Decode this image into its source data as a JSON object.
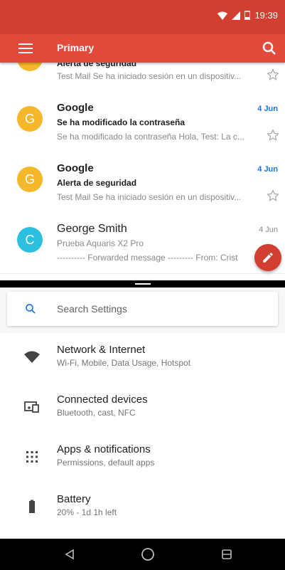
{
  "status_bar": {
    "time": "19:39"
  },
  "app_bar": {
    "title": "Primary"
  },
  "emails": [
    {
      "sender": "Alerta de seguridad",
      "subject": "",
      "snippet": "Test Mail Se ha iniciado sesión en un dispositiv...",
      "date": "",
      "avatar_letter": "G",
      "avatar_color": "#f6b82b",
      "unread": true
    },
    {
      "sender": "Google",
      "subject": "Se ha modificado la contraseña",
      "snippet": "Se ha modificado la contraseña Hola, Test: La c...",
      "date": "4 Jun",
      "avatar_letter": "G",
      "avatar_color": "#f6b82b",
      "unread": true
    },
    {
      "sender": "Google",
      "subject": "Alerta de seguridad",
      "snippet": "Test Mail Se ha iniciado sesión en un dispositiv...",
      "date": "4 Jun",
      "avatar_letter": "G",
      "avatar_color": "#f6b82b",
      "unread": true
    },
    {
      "sender": "George Smith",
      "subject": "Prueba Aquaris X2 Pro",
      "snippet": "---------- Forwarded message --------- From: Crist",
      "date": "4 Jun",
      "avatar_letter": "C",
      "avatar_color": "#2bbfe0",
      "unread": false
    }
  ],
  "settings": {
    "search_placeholder": "Search Settings",
    "items": [
      {
        "title": "Network & Internet",
        "subtitle": "Wi-Fi, Mobile, Data Usage, Hotspot",
        "icon": "wifi-icon"
      },
      {
        "title": "Connected devices",
        "subtitle": "Bluetooth, cast, NFC",
        "icon": "devices-icon"
      },
      {
        "title": "Apps & notifications",
        "subtitle": "Permissions, default apps",
        "icon": "apps-icon"
      },
      {
        "title": "Battery",
        "subtitle": "20% - 1d 1h left",
        "icon": "battery-icon"
      }
    ]
  },
  "colors": {
    "brand_red": "#d23f31",
    "link_blue": "#1a73e8"
  }
}
